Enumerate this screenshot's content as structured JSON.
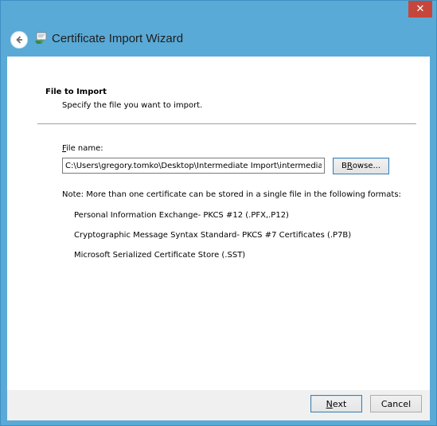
{
  "window": {
    "close_glyph": "✕"
  },
  "header": {
    "title": "Certificate Import Wizard",
    "back_icon": "back-arrow-icon",
    "wizard_icon": "certificate-icon"
  },
  "page": {
    "section_title": "File to Import",
    "section_desc": "Specify the file you want to import.",
    "file_label_accel": "F",
    "file_label_rest": "ile name:",
    "file_value": "C:\\Users\\gregory.tomko\\Desktop\\Intermediate Import\\intermediate",
    "browse_accel": "R",
    "browse_pre": "B",
    "browse_rest": "owse...",
    "note": "Note:  More than one certificate can be stored in a single file in the following formats:",
    "formats": [
      "Personal Information Exchange- PKCS #12 (.PFX,.P12)",
      "Cryptographic Message Syntax Standard- PKCS #7 Certificates (.P7B)",
      "Microsoft Serialized Certificate Store (.SST)"
    ]
  },
  "footer": {
    "next_accel": "N",
    "next_rest": "ext",
    "cancel": "Cancel"
  },
  "colors": {
    "frame": "#5aaad7",
    "close": "#c7463b",
    "accent_border": "#3c7fb1"
  }
}
